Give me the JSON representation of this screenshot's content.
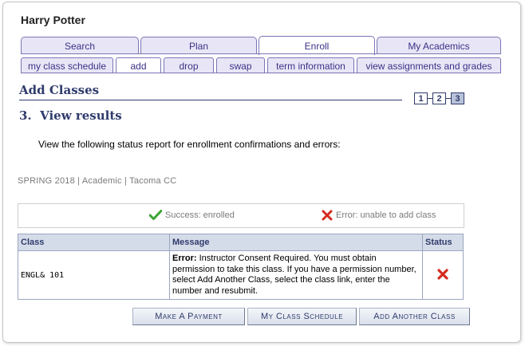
{
  "student": {
    "name": "Harry Potter"
  },
  "main_tabs": [
    {
      "label": "Search"
    },
    {
      "label": "Plan"
    },
    {
      "label": "Enroll"
    },
    {
      "label": "My Academics"
    }
  ],
  "sub_tabs": [
    {
      "label": "my class schedule"
    },
    {
      "label": "add"
    },
    {
      "label": "drop"
    },
    {
      "label": "swap"
    },
    {
      "label": "term information"
    },
    {
      "label": "view assignments and grades"
    }
  ],
  "page": {
    "title": "Add Classes",
    "steps": [
      "1",
      "2",
      "3"
    ],
    "current_step": "3",
    "step_heading": "3.  View results",
    "instructions": "View the following status report for enrollment confirmations and errors:",
    "term_info": "SPRING 2018 | Academic | Tacoma CC"
  },
  "legend": {
    "success": "Success: enrolled",
    "error": "Error: unable to add class"
  },
  "results": {
    "columns": [
      "Class",
      "Message",
      "Status"
    ],
    "rows": [
      {
        "class": "ENGL& 101",
        "message_prefix": "Error:",
        "message": " Instructor Consent Required. You must obtain permission to take this class. If you have a permission number, select Add Another Class, select the class link, enter the number and resubmit.",
        "status_icon": "error-x-icon"
      }
    ]
  },
  "buttons": {
    "make_payment": "Make A Payment",
    "my_class_schedule": "My Class Schedule",
    "add_another_class": "Add Another Class"
  },
  "colors": {
    "tab_border": "#7a75b6",
    "tab_text": "#3b3187",
    "heading": "#2f3b6b",
    "success_green": "#3aa533",
    "error_red": "#d42b1f"
  }
}
